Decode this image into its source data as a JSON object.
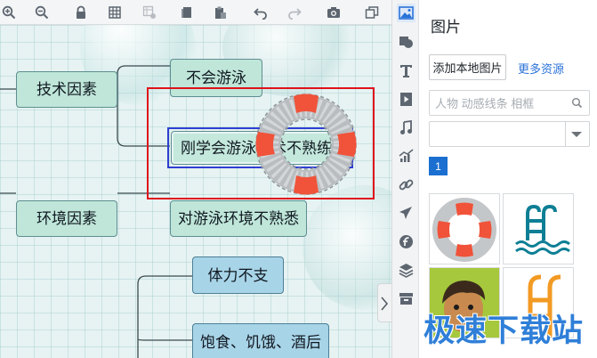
{
  "toolbar": {
    "icons": [
      "zoom-in-icon",
      "zoom-out-icon",
      "lock-icon",
      "grid-icon",
      "grid-settings-icon",
      "copy-icon",
      "paste-icon",
      "undo-icon",
      "redo-icon",
      "camera-icon",
      "window-icon"
    ]
  },
  "mindmap": {
    "nodes": {
      "tech_factors": "技术因素",
      "cannot_swim": "不会游泳",
      "new_learner": "刚学会游泳技术不熟练",
      "env_factors": "环境因素",
      "unfamiliar_env": "对游泳环境不熟悉",
      "stamina": "体力不支",
      "hunger": "饱食、饥饿、酒后"
    },
    "inserted_image": "life-ring-image"
  },
  "rail": {
    "items": [
      "image-icon",
      "shape-icon",
      "text-icon",
      "video-icon",
      "music-icon",
      "chart-icon",
      "link-icon",
      "plane-icon",
      "flash-icon",
      "layers-icon",
      "archive-icon"
    ],
    "active": "image-icon"
  },
  "panel": {
    "title": "图片",
    "add_local_label": "添加本地图片",
    "more_link": "更多资源",
    "search_placeholder": "人物 动感线条 相框",
    "category_value": "",
    "page": "1",
    "thumbnails": [
      "life-ring",
      "pool-ladder",
      "cartoon-boy",
      "ladder-orange"
    ]
  },
  "colors": {
    "accent": "#1b6fd0",
    "link": "#2a72d8",
    "node_green": "#bfe6d9",
    "node_blue": "#a8d4e8",
    "selection_blue": "#2f3fd1",
    "frame_red": "#e0121b",
    "ring_red": "#f0533a"
  },
  "watermark": "极速下载站"
}
